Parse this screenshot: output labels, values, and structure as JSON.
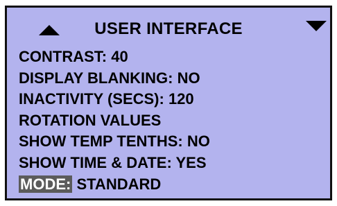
{
  "screen": {
    "title": "USER INTERFACE",
    "colors": {
      "background": "#b3b3ee",
      "text": "#000000",
      "highlight": "#5b5b5b",
      "highlight_text": "#ffffff"
    },
    "icons": {
      "scroll_up": "triangle-up-icon",
      "scroll_down": "triangle-down-icon"
    }
  },
  "menu": {
    "items": [
      "CONTRAST: 40",
      "DISPLAY BLANKING: NO",
      "INACTIVITY (SECS): 120",
      "ROTATION VALUES",
      "SHOW TEMP TENTHS: NO",
      "SHOW TIME & DATE: YES"
    ],
    "mode": {
      "label": "MODE:",
      "value": "STANDARD"
    }
  }
}
